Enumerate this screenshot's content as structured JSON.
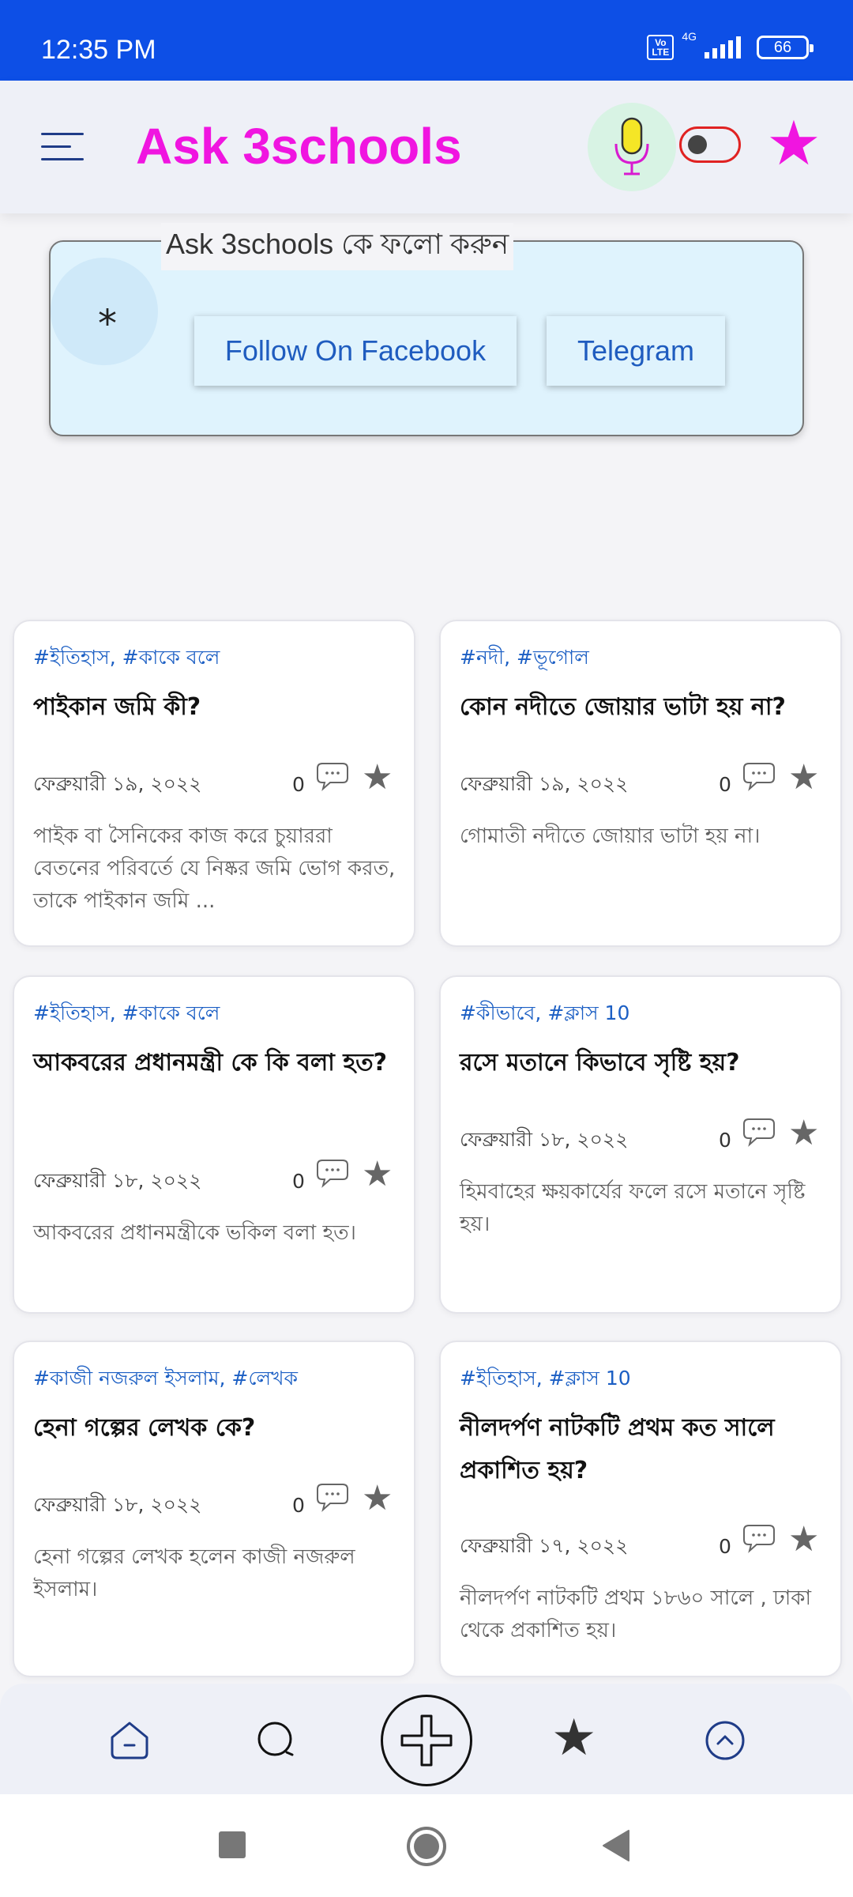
{
  "status_bar": {
    "time": "12:35 PM",
    "volte": "Vo LTE",
    "network": "4G",
    "battery": "66"
  },
  "header": {
    "title": "Ask 3schools"
  },
  "follow": {
    "legend": "Ask 3schools কে ফলো করুন",
    "asterisk": "*",
    "facebook_label": "Follow On Facebook",
    "telegram_label": "Telegram"
  },
  "cards": [
    {
      "tags": "#ইতিহাস, #কাকে বলে",
      "title": "পাইকান জমি কী?",
      "date": "ফেব্রুয়ারী ১৯, ২০২২",
      "comments": "0",
      "excerpt": "পাইক বা সৈনিকের কাজ করে চুয়াররা বেতনের পরিবর্তে যে নিষ্কর জমি ভোগ করত, তাকে পাইকান জমি ..."
    },
    {
      "tags": "#নদী, #ভূগোল",
      "title": "কোন নদীতে জোয়ার ভাটা হয় না?",
      "date": "ফেব্রুয়ারী ১৯, ২০২২",
      "comments": "0",
      "excerpt": "গোমাতী নদীতে জোয়ার ভাটা হয় না।"
    },
    {
      "tags": "#ইতিহাস, #কাকে বলে",
      "title": "আকবরের প্রধানমন্ত্রী কে কি বলা হত?",
      "date": "ফেব্রুয়ারী ১৮, ২০২২",
      "comments": "0",
      "excerpt": "আকবরের প্রধানমন্ত্রীকে ভকিল বলা হত।"
    },
    {
      "tags": "#কীভাবে, #ক্লাস 10",
      "title": "রসে মতানে কিভাবে সৃষ্টি হয়?",
      "date": "ফেব্রুয়ারী ১৮, ২০২২",
      "comments": "0",
      "excerpt": "হিমবাহের ক্ষয়কার্যের ফলে রসে মতানে সৃষ্টি হয়।"
    },
    {
      "tags": "#কাজী নজরুল ইসলাম, #লেখক",
      "title": "হেনা গল্পের লেখক কে?",
      "date": "ফেব্রুয়ারী ১৮, ২০২২",
      "comments": "0",
      "excerpt": "হেনা গল্পের লেখক হলেন কাজী নজরুল ইসলাম।"
    },
    {
      "tags": "#ইতিহাস, #ক্লাস 10",
      "title": "নীলদর্পণ নাটকটি প্রথম কত সালে প্রকাশিত হয়?",
      "date": "ফেব্রুয়ারী ১৭, ২০২২",
      "comments": "0",
      "excerpt": "নীলদর্পণ নাটকটি প্রথম ১৮৬০ সালে , ঢাকা থেকে প্রকাশিত হয়।"
    }
  ],
  "colors": {
    "status_bar": "#0d4fe6",
    "brand": "#f015e0",
    "link": "#1c5fc4",
    "follow_bg": "#dff3fd"
  },
  "icons": {
    "header": [
      "menu-icon",
      "microphone-icon",
      "theme-toggle",
      "star-icon"
    ],
    "bottom_nav": [
      "home-icon",
      "search-icon",
      "add-icon",
      "star-icon",
      "scroll-up-icon"
    ],
    "system_nav": [
      "recents-icon",
      "home-icon",
      "back-icon"
    ]
  }
}
